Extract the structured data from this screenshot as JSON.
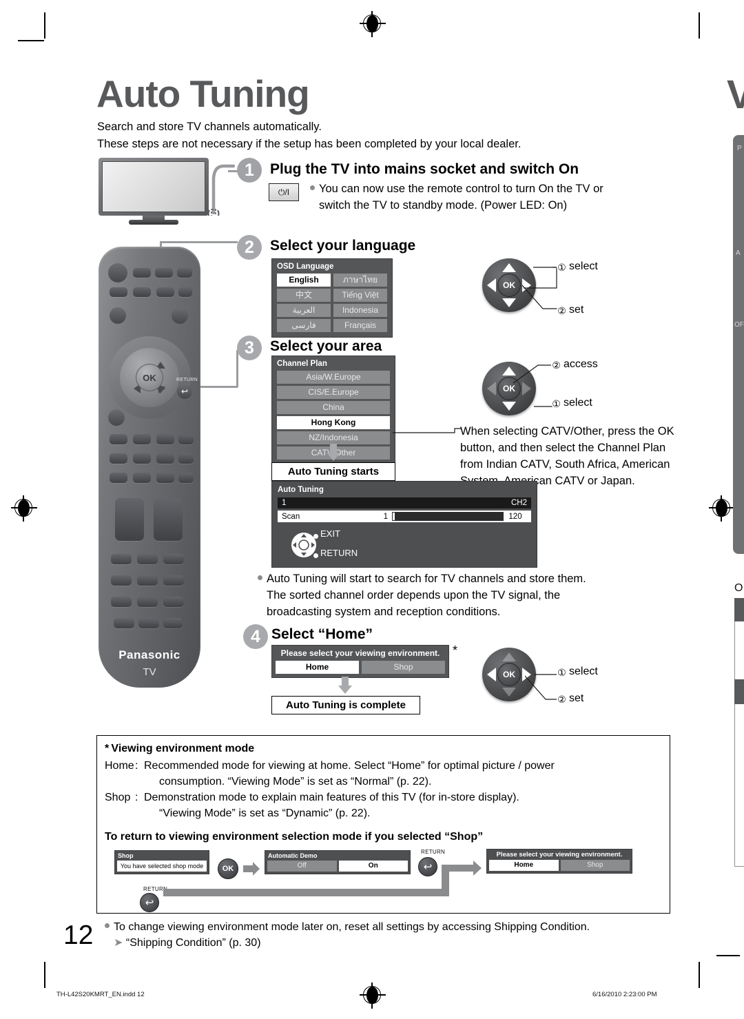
{
  "page": {
    "title": "Auto Tuning",
    "intro_line1": "Search and store TV channels automatically.",
    "intro_line2": "These steps are not necessary if the setup has been completed by your local dealer.",
    "page_number": "12"
  },
  "footer": {
    "left": "TH-L42S20KMRT_EN.indd   12",
    "right": "6/16/2010   2:23:00 PM"
  },
  "steps": {
    "step1": {
      "number": "1",
      "title": "Plug the TV into mains socket and switch On",
      "power_button_label": "⏻/I",
      "bullet_line1": "You can now use the remote control to turn On the TV or",
      "bullet_line2": "switch the TV to standby mode. (Power LED: On)"
    },
    "step2": {
      "number": "2",
      "title": "Select your language",
      "osd": {
        "title": "OSD Language",
        "rows": [
          {
            "left": "English",
            "left_selected": true,
            "right": "ภาษาไทย",
            "right_selected": false
          },
          {
            "left": "中文",
            "left_selected": false,
            "right": "Tiếng Việt",
            "right_selected": false
          },
          {
            "left": "العربية",
            "left_selected": false,
            "right": "Indonesia",
            "right_selected": false
          },
          {
            "left": "فارسی",
            "left_selected": false,
            "right": "Français",
            "right_selected": false
          }
        ]
      },
      "callouts": [
        {
          "num": "①",
          "label": "select"
        },
        {
          "num": "②",
          "label": "set"
        }
      ]
    },
    "step3": {
      "number": "3",
      "title": "Select your area",
      "osd": {
        "title": "Channel Plan",
        "items": [
          {
            "label": "Asia/W.Europe",
            "selected": false
          },
          {
            "label": "CIS/E.Europe",
            "selected": false
          },
          {
            "label": "China",
            "selected": false
          },
          {
            "label": "Hong Kong",
            "selected": true
          },
          {
            "label": "NZ/Indonesia",
            "selected": false
          },
          {
            "label": "CATV/Other",
            "selected": false
          }
        ]
      },
      "callouts": [
        {
          "num": "②",
          "label": "access"
        },
        {
          "num": "①",
          "label": "select"
        }
      ],
      "catv_note_line1": "When selecting CATV/Other, press the OK",
      "catv_note_line2": "button, and then select the Channel Plan",
      "catv_note_line3": "from Indian CATV, South Africa, American",
      "catv_note_line4": "System, American CATV or Japan.",
      "starts_label": "Auto Tuning starts",
      "progress": {
        "title": "Auto Tuning",
        "channel_index": "1",
        "channel_name": "CH2",
        "scan_label": "Scan",
        "scan_current": "1",
        "scan_total": "120",
        "key_exit": "EXIT",
        "key_return": "RETURN"
      },
      "bullet_line1": "Auto Tuning will start to search for TV channels and store them.",
      "bullet_line2": "The sorted channel order depends upon the TV signal, the",
      "bullet_line3": "broadcasting system and reception conditions."
    },
    "step4": {
      "number": "4",
      "title": "Select “Home”",
      "asterisk": "*",
      "osd": {
        "title": "Please select your viewing environment.",
        "options": [
          {
            "label": "Home",
            "selected": true
          },
          {
            "label": "Shop",
            "selected": false
          }
        ]
      },
      "complete_label": "Auto Tuning is complete",
      "callouts": [
        {
          "num": "①",
          "label": "select"
        },
        {
          "num": "②",
          "label": "set"
        }
      ]
    }
  },
  "remote": {
    "brand": "Panasonic",
    "sub_brand": "TV",
    "ok_label": "OK",
    "return_label": "RETURN"
  },
  "info_box": {
    "heading": "* Viewing environment mode",
    "home_key": "Home",
    "home_colon": ":",
    "home_line1": "Recommended mode for viewing at home. Select “Home” for optimal picture / power",
    "home_line2": "consumption. “Viewing Mode” is set as “Normal” (p. 22).",
    "shop_key": "Shop",
    "shop_colon": ":",
    "shop_line1": "Demonstration mode to explain main features of this TV (for in-store display).",
    "shop_line2": "“Viewing Mode” is set as “Dynamic” (p. 22).",
    "return_heading": "To return to viewing environment selection mode if you selected “Shop”",
    "diagram": {
      "shop_title": "Shop",
      "shop_message": "You have selected shop mode",
      "ok_label": "OK",
      "return_label": "RETURN",
      "demo_title": "Automatic Demo",
      "demo_options": [
        {
          "label": "Off",
          "selected": false
        },
        {
          "label": "On",
          "selected": true
        }
      ],
      "env_title": "Please select your viewing environment.",
      "env_options": [
        {
          "label": "Home",
          "selected": true
        },
        {
          "label": "Shop",
          "selected": false
        }
      ]
    },
    "footer_bullet": "To change viewing environment mode later on, reset all settings by accessing Shipping Condition.",
    "footer_arrow_text": "“Shipping Condition” (p. 30)"
  },
  "bleed": {
    "title_fragment": "V",
    "letter_fragment": "O",
    "panel_labels": [
      "P",
      "A",
      "OF"
    ]
  },
  "colors": {
    "title_gray": "#58595b",
    "step_circle": "#a7a9ac",
    "osd_bg": "#555658",
    "osd_item": "#8a8c8e",
    "selected": "#ffffff"
  }
}
